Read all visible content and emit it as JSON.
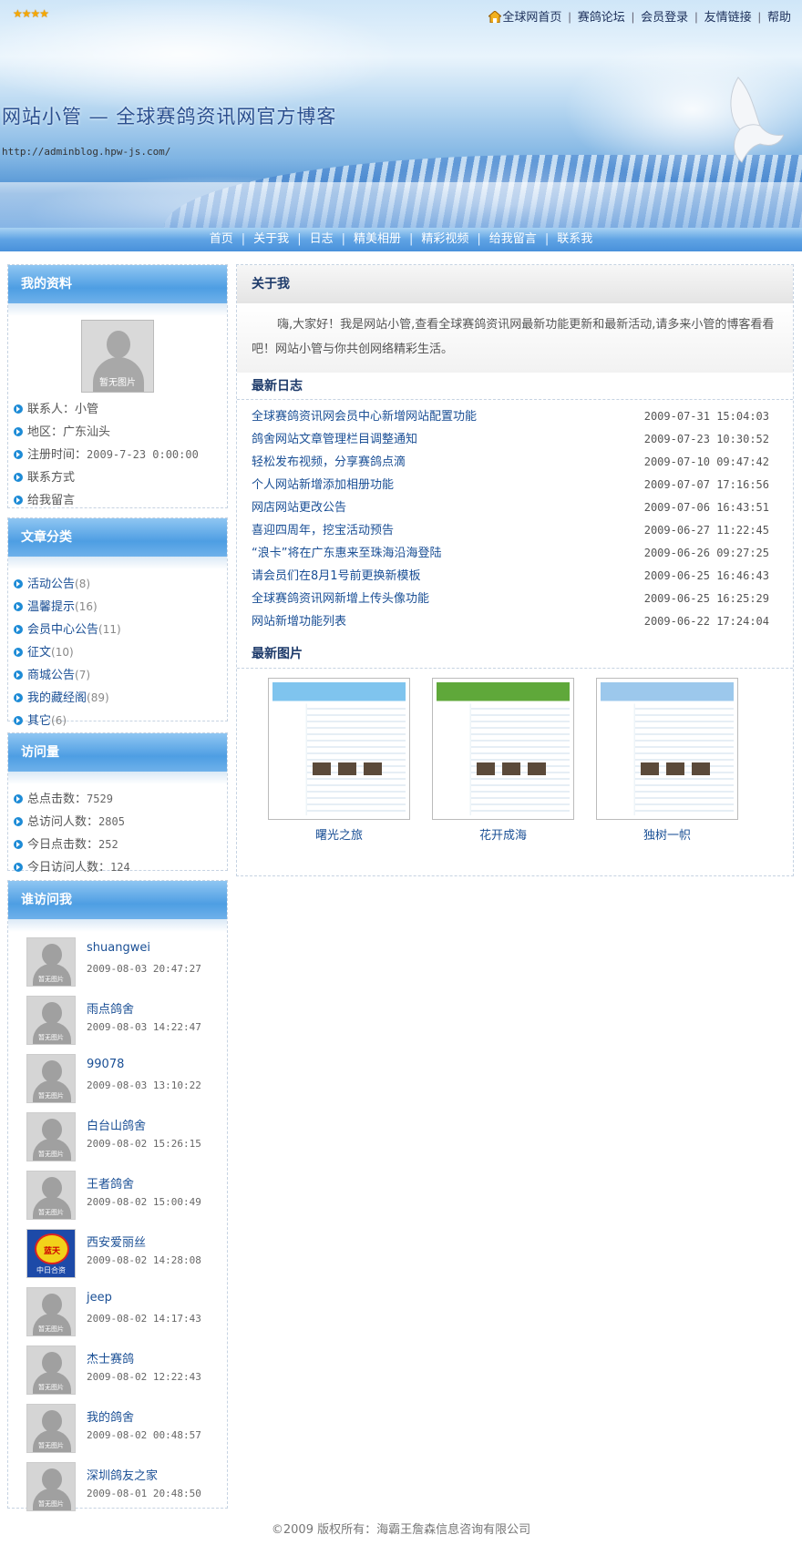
{
  "header": {
    "stars": "★★★★",
    "top_nav": [
      "全球网首页",
      "赛鸽论坛",
      "会员登录",
      "友情链接",
      "帮助"
    ],
    "title": "网站小管 — 全球赛鸽资讯网官方博客",
    "url": "http://adminblog.hpw-js.com/"
  },
  "main_nav": [
    "首页",
    "关于我",
    "日志",
    "精美相册",
    "精彩视频",
    "给我留言",
    "联系我"
  ],
  "profile": {
    "heading": "我的资料",
    "avatar_caption": "暂无图片",
    "contact_label": "联系人：",
    "contact_value": "小管",
    "region_label": "地区：",
    "region_value": "广东汕头",
    "register_label": "注册时间：",
    "register_value": "2009-7-23 0:00:00",
    "contact_way": "联系方式",
    "leave_msg": "给我留言"
  },
  "categories": {
    "heading": "文章分类",
    "items": [
      {
        "name": "活动公告",
        "count": "(8)"
      },
      {
        "name": "温馨提示",
        "count": "(16)"
      },
      {
        "name": "会员中心公告",
        "count": "(11)"
      },
      {
        "name": "征文",
        "count": "(10)"
      },
      {
        "name": "商城公告",
        "count": "(7)"
      },
      {
        "name": "我的藏经阁",
        "count": "(89)"
      },
      {
        "name": "其它",
        "count": "(6)"
      }
    ]
  },
  "visits": {
    "heading": "访问量",
    "items": [
      {
        "label": "总点击数：",
        "value": "7529"
      },
      {
        "label": "总访问人数：",
        "value": "2805"
      },
      {
        "label": "今日点击数：",
        "value": "252"
      },
      {
        "label": "今日访问人数：",
        "value": "124"
      }
    ]
  },
  "visitors": {
    "heading": "谁访问我",
    "avatar_caption": "暂无图片",
    "items": [
      {
        "name": "shuangwei",
        "time": "2009-08-03 20:47:27"
      },
      {
        "name": "雨点鸽舍",
        "time": "2009-08-03 14:22:47"
      },
      {
        "name": "99078",
        "time": "2009-08-03 13:10:22"
      },
      {
        "name": "白台山鸽舍",
        "time": "2009-08-02 15:26:15"
      },
      {
        "name": "王者鸽舍",
        "time": "2009-08-02 15:00:49"
      },
      {
        "name": "西安爱丽丝",
        "time": "2009-08-02 14:28:08",
        "logo": "蓝天",
        "logo_caption": "中日合资"
      },
      {
        "name": "jeep",
        "time": "2009-08-02 14:17:43"
      },
      {
        "name": "杰士赛鸽",
        "time": "2009-08-02 12:22:43"
      },
      {
        "name": "我的鸽舍",
        "time": "2009-08-02 00:48:57"
      },
      {
        "name": "深圳鸽友之家",
        "time": "2009-08-01 20:48:50"
      }
    ]
  },
  "about": {
    "heading": "关于我",
    "text": "嗨,大家好！我是网站小管,查看全球赛鸽资讯网最新功能更新和最新活动,请多来小管的博客看看吧！网站小管与你共创网络精彩生活。"
  },
  "logs": {
    "heading": "最新日志",
    "items": [
      {
        "title": "全球赛鸽资讯网会员中心新增网站配置功能",
        "date": "2009-07-31 15:04:03"
      },
      {
        "title": "鸽舍网站文章管理栏目调整通知",
        "date": "2009-07-23 10:30:52"
      },
      {
        "title": "轻松发布视频，分享赛鸽点滴",
        "date": "2009-07-10 09:47:42"
      },
      {
        "title": "个人网站新增添加相册功能",
        "date": "2009-07-07 17:16:56"
      },
      {
        "title": "网店网站更改公告",
        "date": "2009-07-06 16:43:51"
      },
      {
        "title": "喜迎四周年，挖宝活动预告",
        "date": "2009-06-27 11:22:45"
      },
      {
        "title": "“浪卡”将在广东惠来至珠海沿海登陆",
        "date": "2009-06-26 09:27:25"
      },
      {
        "title": "请会员们在8月1号前更换新模板",
        "date": "2009-06-25 16:46:43"
      },
      {
        "title": "全球赛鸽资讯网新增上传头像功能",
        "date": "2009-06-25 16:25:29"
      },
      {
        "title": "网站新增功能列表",
        "date": "2009-06-22 17:24:04"
      }
    ]
  },
  "pictures": {
    "heading": "最新图片",
    "items": [
      {
        "caption": "曙光之旅",
        "theme": "#7fc4ee"
      },
      {
        "caption": "花开成海",
        "theme": "#5fa83a"
      },
      {
        "caption": "独树一帜",
        "theme": "#9cc8ec"
      }
    ]
  },
  "footer": "©2009 版权所有：海霸王詹森信息咨询有限公司",
  "colors": {
    "accent": "#4e9ee3",
    "link": "#1a4f95",
    "nav_bar": "#5fa3e4"
  }
}
